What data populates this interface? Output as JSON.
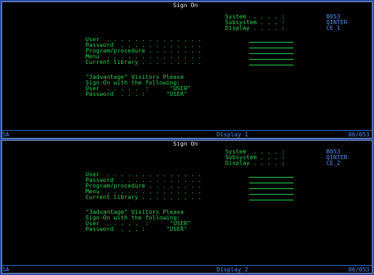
{
  "screens": [
    {
      "title": "Sign On",
      "system": {
        "label": "System  . . . . :",
        "value": "B053"
      },
      "subsystem": {
        "label": "Subsystem . . . :",
        "value": "QINTER"
      },
      "display": {
        "label": "Display . . . . :",
        "value": "CE_1"
      },
      "fields": [
        {
          "label": "User  . . . . . . . . . . . . . ."
        },
        {
          "label": "Password  . . . . . . . . . . . ."
        },
        {
          "label": "Program/procedure . . . . . . . ."
        },
        {
          "label": "Menu  . . . . . . . . . . . . . ."
        },
        {
          "label": "Current library . . . . . . . . ."
        }
      ],
      "notice": {
        "line1": "\"Jadvantage\" Visitors Please",
        "line2": "Sign-On with the following:",
        "user_line": "User  . . . . .  :      \"USER\"",
        "password_line": "Password  . . . :      \"USER\""
      },
      "status": {
        "left": "SA",
        "center": "Display 1",
        "right": "06/053"
      }
    },
    {
      "title": "Sign On",
      "system": {
        "label": "System  . . . . :",
        "value": "B053"
      },
      "subsystem": {
        "label": "Subsystem . . . :",
        "value": "QINTER"
      },
      "display": {
        "label": "Display . . . . :",
        "value": "CE_2"
      },
      "fields": [
        {
          "label": "User  . . . . . . . . . . . . . ."
        },
        {
          "label": "Password  . . . . . . . . . . . ."
        },
        {
          "label": "Program/procedure . . . . . . . ."
        },
        {
          "label": "Menu  . . . . . . . . . . . . . ."
        },
        {
          "label": "Current library . . . . . . . . ."
        }
      ],
      "notice": {
        "line1": "\"Jadvantage\" Visitors Please",
        "line2": "Sign-On with the following:",
        "user_line": "User  . . . . .  :      \"USER\"",
        "password_line": "Password  . . . :      \"USER\""
      },
      "status": {
        "left": "SA",
        "center": "Display 2",
        "right": "06/053"
      }
    }
  ]
}
